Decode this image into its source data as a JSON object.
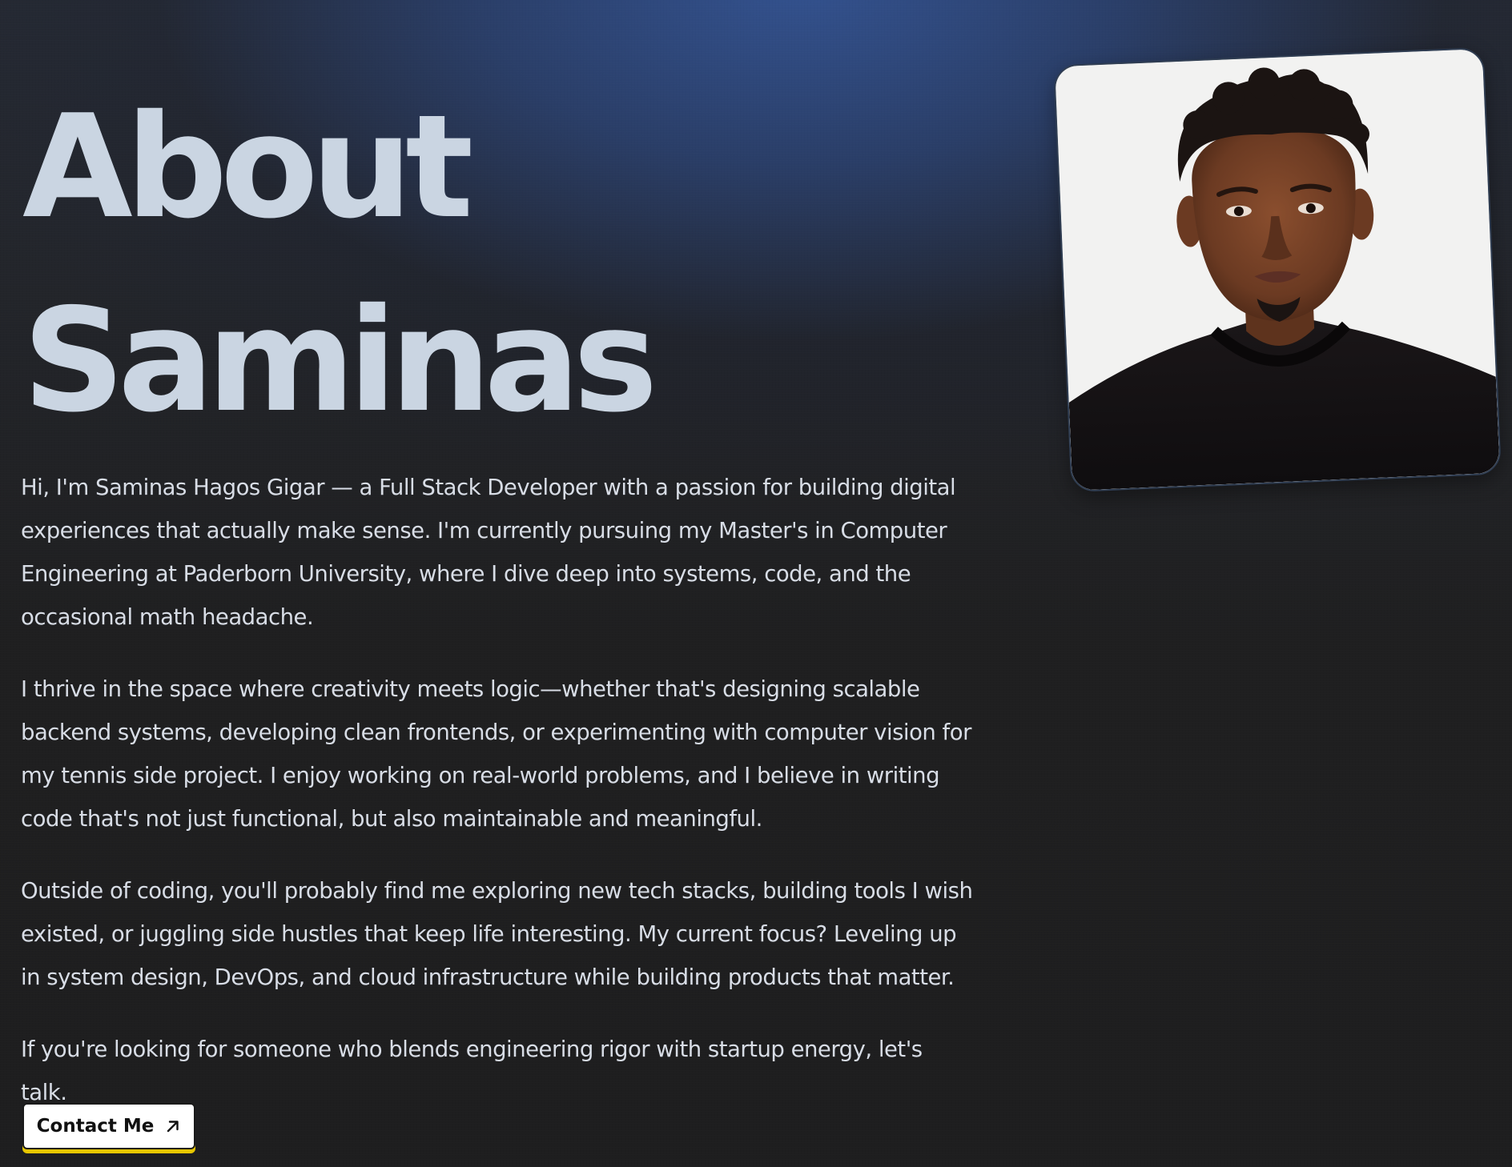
{
  "heading": {
    "line1": "About",
    "line2": "Saminas"
  },
  "bio": {
    "paragraphs": [
      "Hi, I'm Saminas Hagos Gigar — a Full Stack Developer with a passion for building digital experiences that actually make sense. I'm currently pursuing my Master's in Computer Engineering at Paderborn University, where I dive deep into systems, code, and the occasional math headache.",
      "I thrive in the space where creativity meets logic—whether that's designing scalable backend systems, developing clean frontends, or experimenting with computer vision for my tennis side project. I enjoy working on real-world problems, and I believe in writing code that's not just functional, but also maintainable and meaningful.",
      "Outside of coding, you'll probably find me exploring new tech stacks, building tools I wish existed, or juggling side hustles that keep life interesting. My current focus? Leveling up in system design, DevOps, and cloud infrastructure while building products that matter.",
      "If you're looking for someone who blends engineering rigor with startup energy, let's talk."
    ]
  },
  "contact_button": {
    "label": "Contact Me",
    "icon": "arrow-up-right-icon"
  },
  "colors": {
    "heading": "#cad5e2",
    "body_text": "#d8dde6",
    "button_accent": "#e7c700",
    "background_glow": "#345494"
  }
}
